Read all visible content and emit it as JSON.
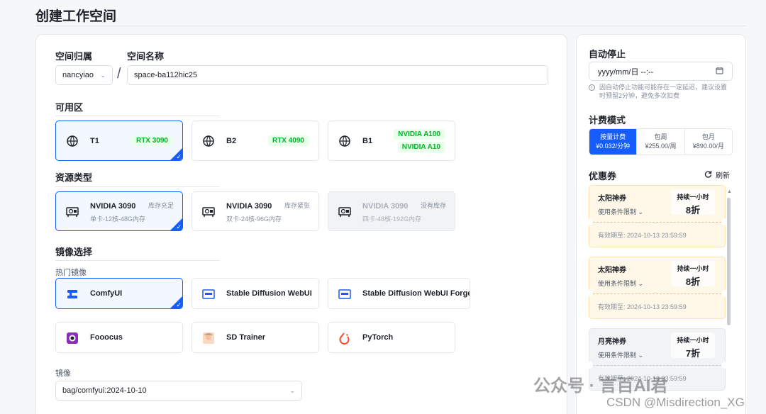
{
  "page": {
    "title": "创建工作空间"
  },
  "space": {
    "owner_label": "空间归属",
    "owner_value": "nancyiao",
    "name_label": "空间名称",
    "name_value": "space-ba112hic25",
    "slash": "/"
  },
  "zone": {
    "title": "可用区",
    "options": [
      {
        "name": "T1",
        "tags": [
          "RTX 3090"
        ],
        "selected": true
      },
      {
        "name": "B2",
        "tags": [
          "RTX 4090"
        ],
        "selected": false
      },
      {
        "name": "B1",
        "tags": [
          "NVIDIA A100",
          "NVIDIA A10"
        ],
        "selected": false
      }
    ]
  },
  "resource": {
    "title": "资源类型",
    "options": [
      {
        "name": "NVIDIA 3090",
        "sub": "单卡-12核-48G内存",
        "stock": "库存充足",
        "selected": true,
        "disabled": false
      },
      {
        "name": "NVIDIA 3090",
        "sub": "双卡-24核-96G内存",
        "stock": "库存紧张",
        "selected": false,
        "disabled": false
      },
      {
        "name": "NVIDIA 3090",
        "sub": "四卡-48核-192G内存",
        "stock": "没有库存",
        "selected": false,
        "disabled": true
      }
    ]
  },
  "image": {
    "title": "镜像选择",
    "hot_label": "热门镜像",
    "options": [
      {
        "name": "ComfyUI",
        "icon": "comfyui-icon",
        "selected": true
      },
      {
        "name": "Stable Diffusion WebUI",
        "icon": "sd-webui-icon",
        "selected": false
      },
      {
        "name": "Stable Diffusion WebUI Forge",
        "icon": "sd-forge-icon",
        "selected": false
      },
      {
        "name": "Fooocus",
        "icon": "fooocus-icon",
        "selected": false
      },
      {
        "name": "SD Trainer",
        "icon": "sd-trainer-icon",
        "selected": false
      },
      {
        "name": "PyTorch",
        "icon": "pytorch-icon",
        "selected": false
      }
    ],
    "mirror_label": "镜像",
    "mirror_value": "bag/comfyui:2024-10-10"
  },
  "auto_stop": {
    "title": "自动停止",
    "placeholder": "yyyy/mm/日 --:--",
    "hint": "因自动停止功能可能存在一定延迟，建议设置时预留2分钟，避免多次扣费"
  },
  "billing": {
    "title": "计费模式",
    "options": [
      {
        "label": "按量计费",
        "price": "¥0.032/分钟",
        "selected": true
      },
      {
        "label": "包周",
        "price": "¥255.00/周",
        "selected": false
      },
      {
        "label": "包月",
        "price": "¥890.00/月",
        "selected": false
      }
    ]
  },
  "coupons": {
    "title": "优惠券",
    "refresh": "刷新",
    "items": [
      {
        "name": "太阳神券",
        "limit": "使用条件限制",
        "title": "持续一小时",
        "discount": "8折",
        "expiry": "有效期至:   2024-10-13 23:59:59",
        "style": "gold"
      },
      {
        "name": "太阳神券",
        "limit": "使用条件限制",
        "title": "持续一小时",
        "discount": "8折",
        "expiry": "有效期至:   2024-10-13 23:59:59",
        "style": "gold"
      },
      {
        "name": "月亮神券",
        "limit": "使用条件限制",
        "title": "持续一小时",
        "discount": "7折",
        "expiry": "有效期至:   2024-10-13 23:59:59",
        "style": "gray"
      }
    ]
  },
  "watermark": {
    "line1": "公众号 · 言百AI君",
    "line2": "CSDN @Misdirection_XG"
  },
  "colors": {
    "accent": "#165dff",
    "tag_green": "#00b42a",
    "coupon_gold": "#fff8e8"
  }
}
